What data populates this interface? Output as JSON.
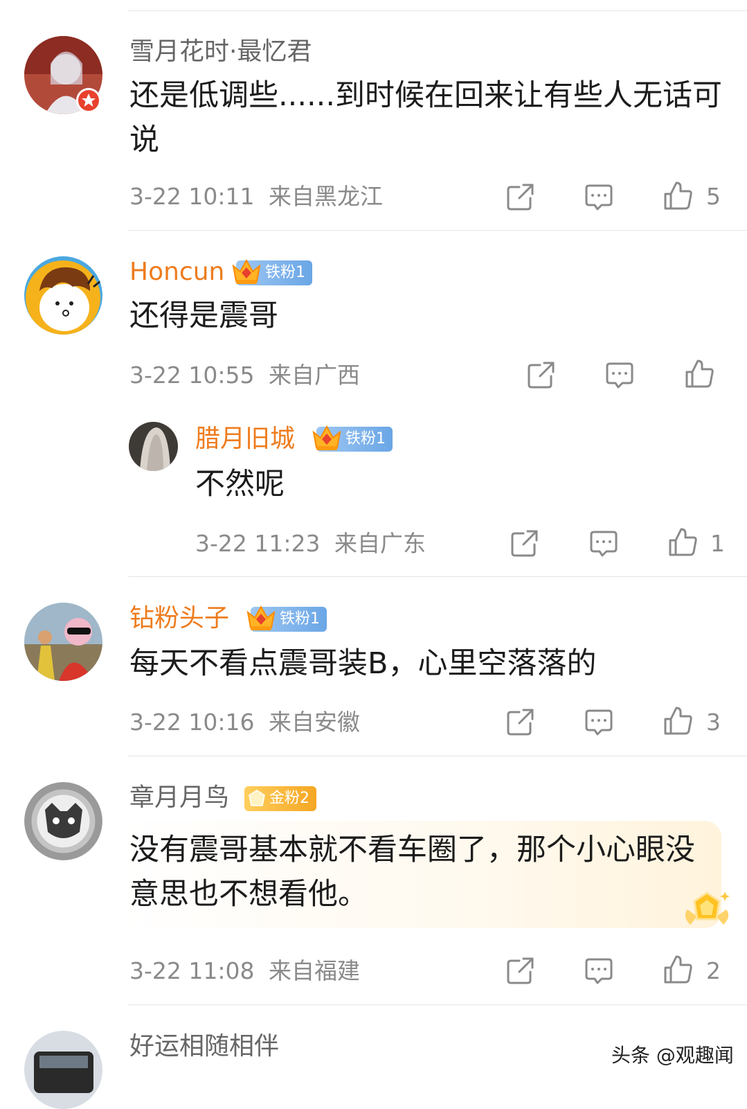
{
  "comments": [
    {
      "username": "雪月花时·最忆君",
      "text": "还是低调些......到时候在回来让有些人无话可说",
      "time": "3-22 10:11",
      "location": "来自黑龙江",
      "likes": "5"
    },
    {
      "username": "Honcun",
      "badge": "铁粉1",
      "text": "还得是震哥",
      "time": "3-22 10:55",
      "location": "来自广西",
      "likes": ""
    },
    {
      "username": "腊月旧城",
      "badge": "铁粉1",
      "text": "不然呢",
      "time": "3-22 11:23",
      "location": "来自广东",
      "likes": "1"
    },
    {
      "username": "钻粉头子",
      "badge": "铁粉1",
      "text": "每天不看点震哥装B，心里空落落的",
      "time": "3-22 10:16",
      "location": "来自安徽",
      "likes": "3"
    },
    {
      "username": "章月月鸟",
      "badge": "金粉2",
      "text": "没有震哥基本就不看车圈了，那个小心眼没意思也不想看他。",
      "time": "3-22 11:08",
      "location": "来自福建",
      "likes": "2"
    },
    {
      "username": "好运相随相伴"
    }
  ],
  "icons": {
    "share": "share-icon",
    "reply": "comment-icon",
    "like": "thumbs-up-icon"
  },
  "watermark": "头条 @观趣闻",
  "colors": {
    "name_orange": "#ee7c1e",
    "meta_gray": "#8a8a8a",
    "badge_iron": "#6aa6e6",
    "badge_gold": "#f5a623"
  }
}
